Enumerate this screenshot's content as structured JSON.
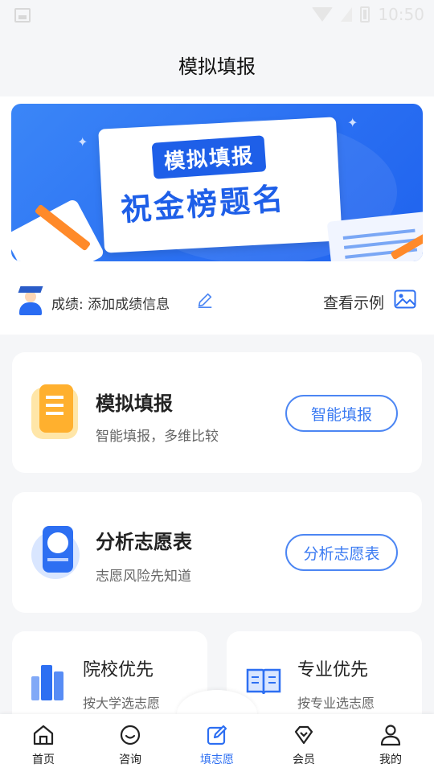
{
  "status_bar": {
    "time": "10:50"
  },
  "header": {
    "title": "模拟填报"
  },
  "banner": {
    "tag": "模拟填报",
    "slogan": "祝金榜题名"
  },
  "score_row": {
    "label": "成绩: 添加成绩信息",
    "example_label": "查看示例"
  },
  "cards": [
    {
      "title": "模拟填报",
      "subtitle": "智能填报，多维比较",
      "button": "智能填报"
    },
    {
      "title": "分析志愿表",
      "subtitle": "志愿风险先知道",
      "button": "分析志愿表"
    }
  ],
  "small_cards": [
    {
      "title": "院校优先",
      "subtitle": "按大学选志愿"
    },
    {
      "title": "专业优先",
      "subtitle": "按专业选志愿"
    }
  ],
  "tabs": [
    {
      "label": "首页",
      "icon": "home-icon"
    },
    {
      "label": "咨询",
      "icon": "chat-icon"
    },
    {
      "label": "填志愿",
      "icon": "edit-icon",
      "active": true
    },
    {
      "label": "会员",
      "icon": "diamond-icon"
    },
    {
      "label": "我的",
      "icon": "user-icon"
    }
  ],
  "colors": {
    "accent": "#2d6ff2",
    "banner": "#2a6ff2",
    "doc_icon": "#ffb02e"
  }
}
